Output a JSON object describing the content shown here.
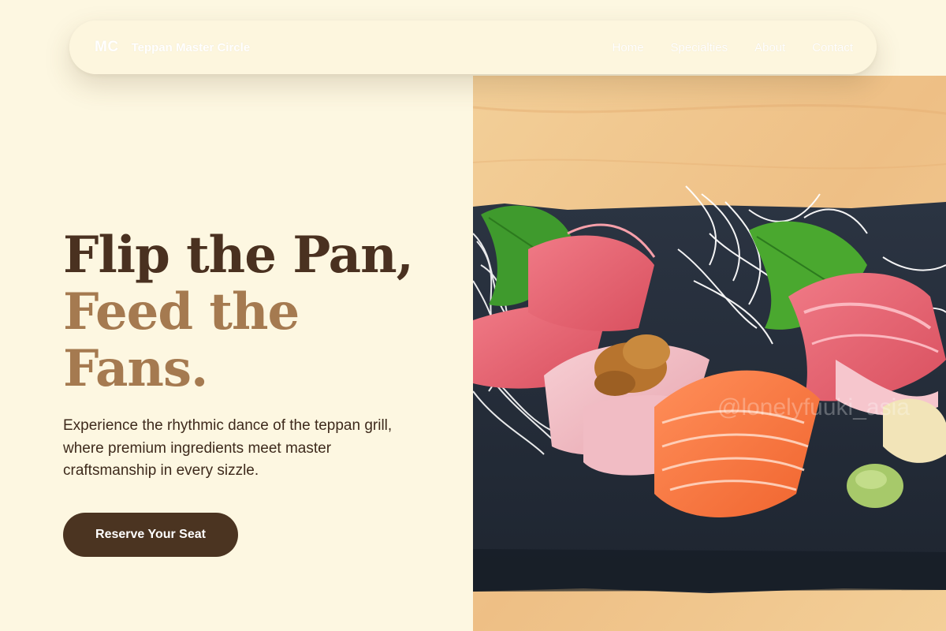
{
  "nav": {
    "logo": "MC",
    "brand_name": "Teppan Master Circle",
    "links": [
      "Home",
      "Specialties",
      "About",
      "Contact"
    ]
  },
  "hero": {
    "headline_line1": "Flip the Pan,",
    "headline_line2a": "Feed the",
    "headline_line2b": "Fans.",
    "subtitle": "Experience the rhythmic dance of the teppan grill, where premium ingredients meet master craftsmanship in every sizzle.",
    "cta_label": "Reserve Your Seat",
    "image_watermark": "@lonelyfuuki_asia"
  },
  "colors": {
    "background": "#fdf7e1",
    "headline_dark": "#4a3120",
    "headline_accent": "#a57a50",
    "button": "#4b3421",
    "body_text": "#3e2a1c"
  }
}
